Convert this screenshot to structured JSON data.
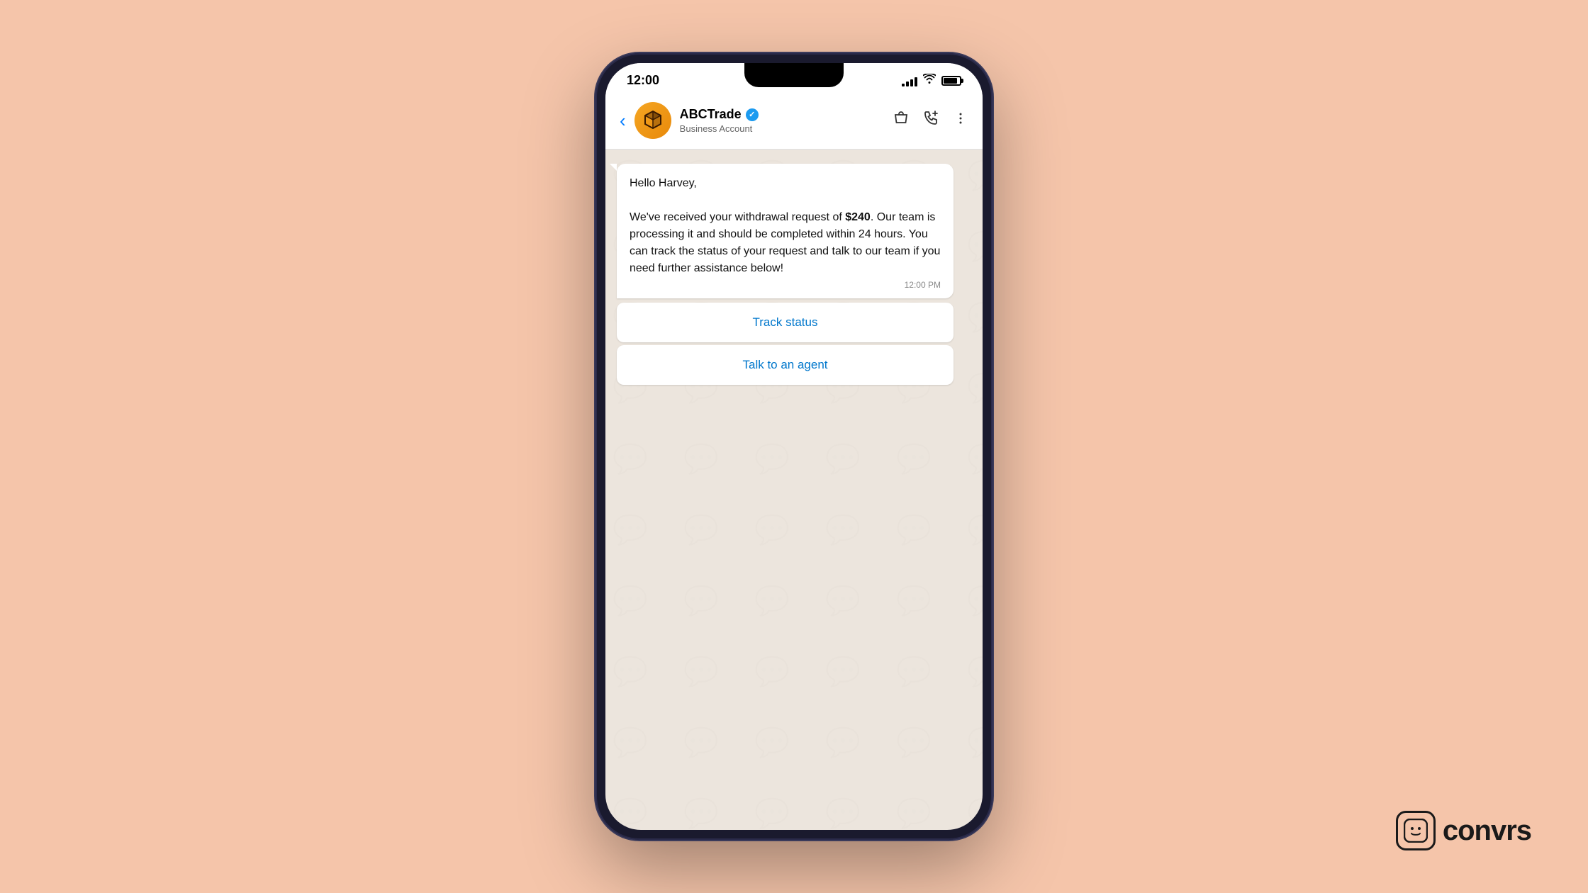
{
  "background": {
    "color": "#f5c5aa"
  },
  "convrs": {
    "logo_text": "convrs",
    "logo_icon": "🙂"
  },
  "phone": {
    "status_bar": {
      "time": "12:00",
      "signal_bars": [
        4,
        6,
        9,
        12,
        15
      ],
      "battery_label": "battery"
    },
    "chat_header": {
      "back_label": "‹",
      "avatar_alt": "ABCTrade logo",
      "name": "ABCTrade",
      "verified": true,
      "subtitle": "Business Account",
      "action_shopping_bag": "🛍",
      "action_call_add": "📞",
      "action_more": "⋮"
    },
    "message": {
      "greeting": "Hello Harvey,",
      "body": "We've received your withdrawal request of ",
      "amount": "$240",
      "body2": ". Our team is processing it and should be completed within 24 hours. You can track the status of your request and talk to our team if you need further assistance below!",
      "timestamp": "12:00 PM"
    },
    "buttons": {
      "track_status": "Track status",
      "talk_to_agent": "Talk to an agent"
    }
  }
}
